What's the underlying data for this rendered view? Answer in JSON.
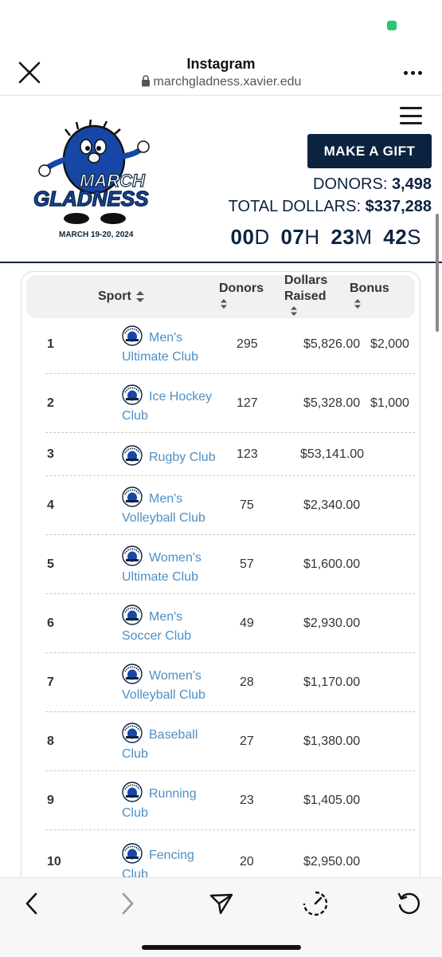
{
  "browser": {
    "title": "Instagram",
    "url": "marchgladness.xavier.edu"
  },
  "site": {
    "logo": {
      "line1": "MARCH",
      "line2": "GLADNESS",
      "dates": "MARCH 19-20, 2024"
    },
    "gift_label": "MAKE A GIFT",
    "donors_label": "DONORS:",
    "donors_value": "3,498",
    "total_label": "TOTAL DOLLARS:",
    "total_value": "$337,288",
    "countdown": {
      "days": "00",
      "days_unit": "D",
      "hours": "07",
      "hours_unit": "H",
      "minutes": "23",
      "minutes_unit": "M",
      "seconds": "42",
      "seconds_unit": "S"
    }
  },
  "table": {
    "columns": {
      "sport": "Sport",
      "donors": "Donors",
      "dollars_line1": "Dollars",
      "dollars_line2": "Raised",
      "bonus": "Bonus"
    },
    "rows": [
      {
        "rank": "1",
        "team_line1": "Men's",
        "team_line2": "Ultimate Club",
        "donors": "295",
        "dollars": "$5,826.00",
        "bonus": "$2,000"
      },
      {
        "rank": "2",
        "team_line1": "Ice Hockey",
        "team_line2": "Club",
        "donors": "127",
        "dollars": "$5,328.00",
        "bonus": "$1,000"
      },
      {
        "rank": "3",
        "team_line1": "Rugby Club",
        "team_line2": "",
        "donors": "123",
        "dollars": "$53,141.00",
        "bonus": ""
      },
      {
        "rank": "4",
        "team_line1": "Men's",
        "team_line2": "Volleyball Club",
        "donors": "75",
        "dollars": "$2,340.00",
        "bonus": ""
      },
      {
        "rank": "5",
        "team_line1": "Women's",
        "team_line2": "Ultimate Club",
        "donors": "57",
        "dollars": "$1,600.00",
        "bonus": ""
      },
      {
        "rank": "6",
        "team_line1": "Men's",
        "team_line2": "Soccer Club",
        "donors": "49",
        "dollars": "$2,930.00",
        "bonus": ""
      },
      {
        "rank": "7",
        "team_line1": "Women's",
        "team_line2": "Volleyball Club",
        "donors": "28",
        "dollars": "$1,170.00",
        "bonus": ""
      },
      {
        "rank": "8",
        "team_line1": "Baseball",
        "team_line2": "Club",
        "donors": "27",
        "dollars": "$1,380.00",
        "bonus": ""
      },
      {
        "rank": "9",
        "team_line1": "Running",
        "team_line2": "Club",
        "donors": "23",
        "dollars": "$1,405.00",
        "bonus": ""
      },
      {
        "rank": "10",
        "team_line1": "Fencing",
        "team_line2": "Club",
        "donors": "20",
        "dollars": "$2,950.00",
        "bonus": ""
      }
    ]
  },
  "colors": {
    "navy": "#0c2340",
    "link_blue": "#4e8fc3",
    "status_green": "#28c76f"
  },
  "icons": [
    "close-icon",
    "lock-icon",
    "more-icon",
    "menu-icon",
    "team-badge-icon",
    "back-icon",
    "forward-icon",
    "share-icon",
    "speed-icon",
    "reload-icon"
  ]
}
